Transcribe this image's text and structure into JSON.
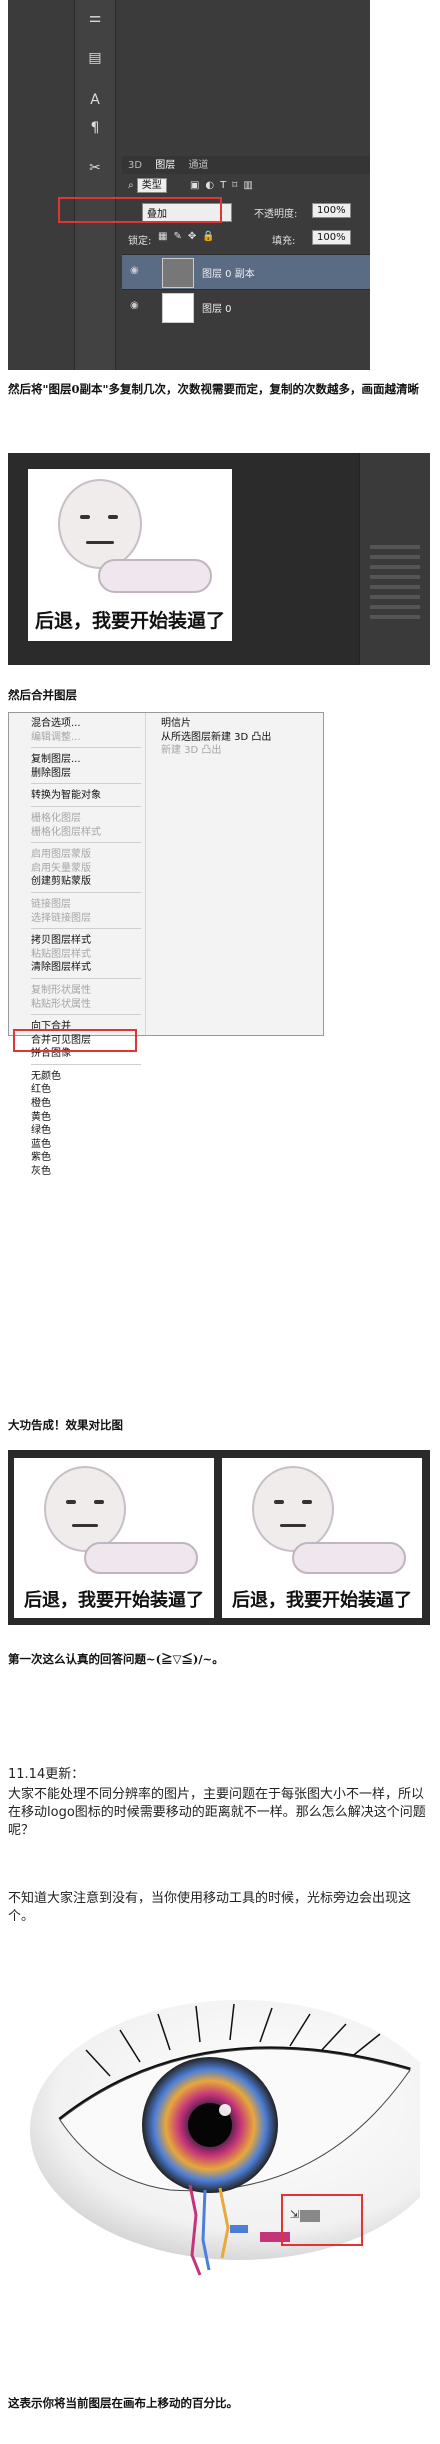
{
  "layers_panel": {
    "tabs": [
      "3D",
      "图层",
      "通道"
    ],
    "filter_label": "类型",
    "blend_mode": "叠加",
    "opacity_label": "不透明度:",
    "opacity_value": "100%",
    "lock_label": "锁定:",
    "fill_label": "填充:",
    "fill_value": "100%",
    "layers": [
      "图层 0 副本",
      "图层 0"
    ]
  },
  "caption1": "然后将\"图层0副本\"多复制几次，次数视需要而定，复制的次数越多，画面越清晰",
  "meme_text": "后退，我要开始装逼了",
  "caption2": "然后合并图层",
  "menu": {
    "left_groups": [
      [
        {
          "label": "混合选项...",
          "enabled": true
        },
        {
          "label": "编辑调整...",
          "enabled": false
        }
      ],
      [
        {
          "label": "复制图层...",
          "enabled": true
        },
        {
          "label": "删除图层",
          "enabled": true
        }
      ],
      [
        {
          "label": "转换为智能对象",
          "enabled": true
        }
      ],
      [
        {
          "label": "栅格化图层",
          "enabled": false
        },
        {
          "label": "栅格化图层样式",
          "enabled": false
        }
      ],
      [
        {
          "label": "启用图层蒙版",
          "enabled": false
        },
        {
          "label": "启用矢量蒙版",
          "enabled": false
        },
        {
          "label": "创建剪贴蒙版",
          "enabled": true
        }
      ],
      [
        {
          "label": "链接图层",
          "enabled": false
        },
        {
          "label": "选择链接图层",
          "enabled": false
        }
      ],
      [
        {
          "label": "拷贝图层样式",
          "enabled": true
        },
        {
          "label": "粘贴图层样式",
          "enabled": false
        },
        {
          "label": "清除图层样式",
          "enabled": true
        }
      ],
      [
        {
          "label": "复制形状属性",
          "enabled": false
        },
        {
          "label": "粘贴形状属性",
          "enabled": false
        }
      ],
      [
        {
          "label": "向下合并",
          "enabled": true
        },
        {
          "label": "合并可见图层",
          "enabled": true
        },
        {
          "label": "拼合图像",
          "enabled": true
        }
      ],
      [
        {
          "label": "无颜色",
          "enabled": true
        },
        {
          "label": "红色",
          "enabled": true
        },
        {
          "label": "橙色",
          "enabled": true
        },
        {
          "label": "黄色",
          "enabled": true
        },
        {
          "label": "绿色",
          "enabled": true
        },
        {
          "label": "蓝色",
          "enabled": true
        },
        {
          "label": "紫色",
          "enabled": true
        },
        {
          "label": "灰色",
          "enabled": true
        }
      ]
    ],
    "right_items": [
      {
        "label": "明信片",
        "enabled": true
      },
      {
        "label": "从所选图层新建 3D 凸出",
        "enabled": true
      },
      {
        "label": "新建 3D 凸出",
        "enabled": false
      }
    ]
  },
  "caption3": "大功告成！效果对比图",
  "caption4": "第一次这么认真的回答问题~(≧▽≦)/~。",
  "update": {
    "heading": "11.14更新：",
    "para1": "大家不能处理不同分辨率的图片，主要问题在于每张图大小不一样，所以在移动logo图标的时候需要移动的距离就不一样。那么怎么解决这个问题呢？",
    "para2": "不知道大家注意到没有，当你使用移动工具的时候，光标旁边会出现这个。"
  },
  "caption5": "这表示你将当前图层在画布上移动的百分比。",
  "colors": {
    "highlight": "#e03535",
    "ps_dark": "#3b3b3b",
    "selected_layer": "#5a6b84"
  }
}
